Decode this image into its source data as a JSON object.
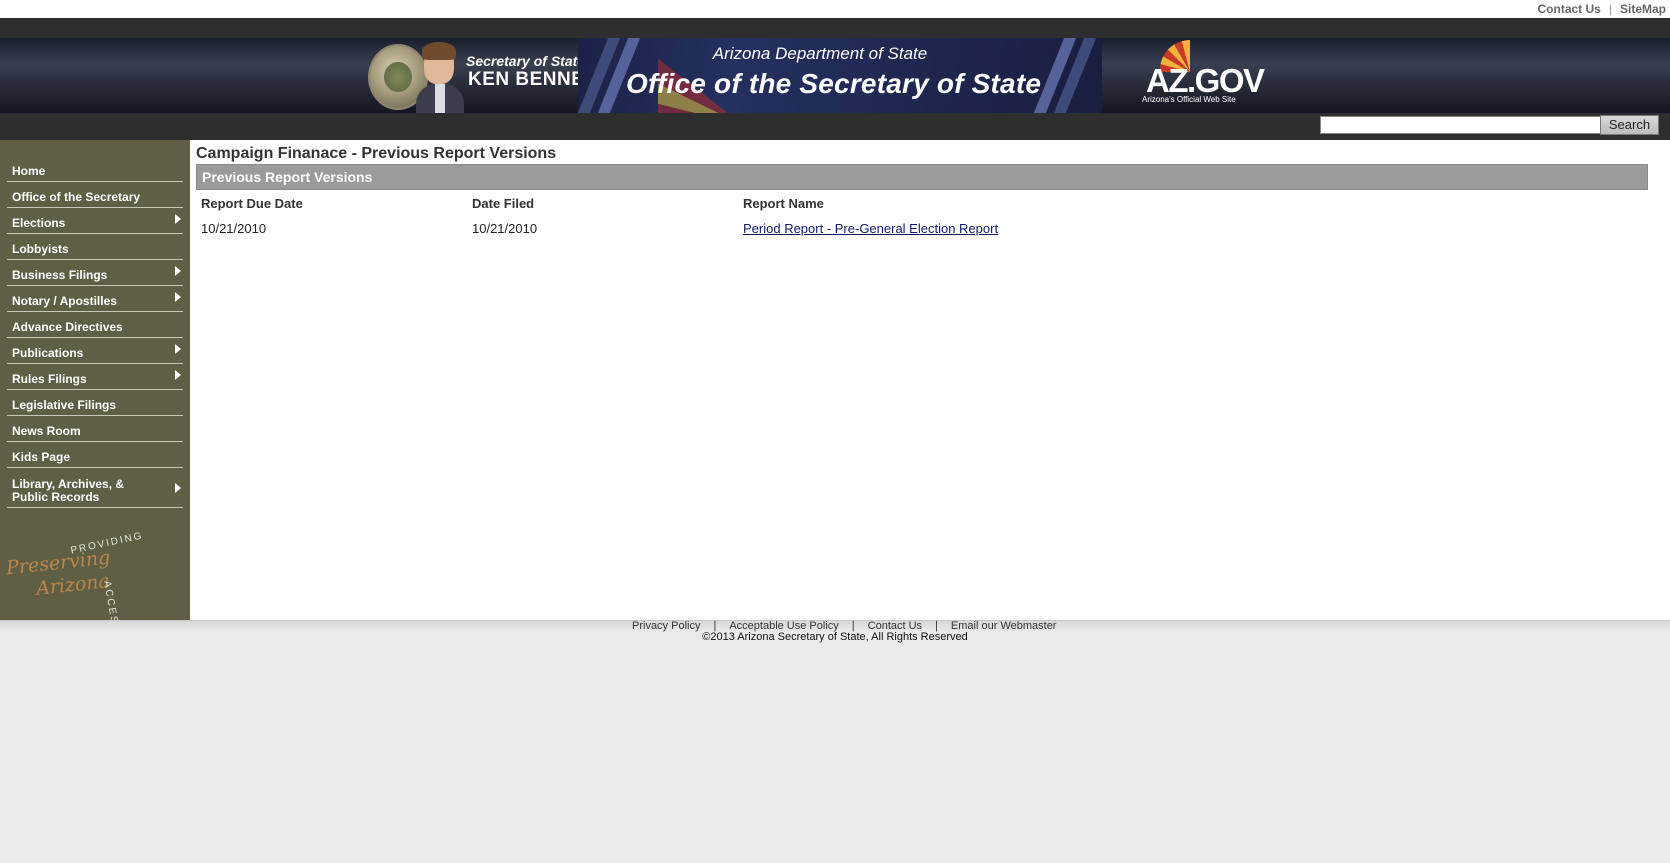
{
  "utility": {
    "contact_us": "Contact Us",
    "separator": "|",
    "sitemap": "SiteMap"
  },
  "banner": {
    "secretary_label": "Secretary of State",
    "secretary_name": "KEN BENNETT",
    "department": "Arizona Department of State",
    "office": "Office of the Secretary of State",
    "azgov_logo": "AZ.GOV",
    "azgov_tagline": "Arizona's Official Web Site"
  },
  "search": {
    "value": "",
    "button_label": "Search"
  },
  "sidebar": {
    "items": [
      {
        "label": "Home",
        "has_submenu": false
      },
      {
        "label": "Office of the Secretary",
        "has_submenu": false
      },
      {
        "label": "Elections",
        "has_submenu": true
      },
      {
        "label": "Lobbyists",
        "has_submenu": false
      },
      {
        "label": "Business Filings",
        "has_submenu": true
      },
      {
        "label": "Notary / Apostilles",
        "has_submenu": true
      },
      {
        "label": "Advance Directives",
        "has_submenu": false
      },
      {
        "label": "Publications",
        "has_submenu": true
      },
      {
        "label": "Rules Filings",
        "has_submenu": true
      },
      {
        "label": "Legislative Filings",
        "has_submenu": false
      },
      {
        "label": "News Room",
        "has_submenu": false
      },
      {
        "label": "Kids Page",
        "has_submenu": false
      },
      {
        "label": "Library, Archives, & Public Records",
        "has_submenu": true
      }
    ],
    "logo": {
      "script_top": "Preserving",
      "script_bottom": "Arizona",
      "arc_top": "PROVIDING",
      "arc_side": "ACCESS"
    }
  },
  "main": {
    "title": "Campaign Finanace - Previous Report Versions",
    "section_title": "Previous Report Versions",
    "columns": [
      "Report Due Date",
      "Date Filed",
      "Report Name"
    ],
    "rows": [
      {
        "due_date": "10/21/2010",
        "date_filed": "10/21/2010",
        "report_name": "Period Report - Pre-General Election Report"
      }
    ]
  },
  "footer": {
    "links": [
      "Privacy Policy",
      "Acceptable Use Policy",
      "Contact Us",
      "Email our Webmaster"
    ],
    "separator": "|",
    "copyright": "©2013 Arizona Secretary of State, All Rights Reserved"
  }
}
